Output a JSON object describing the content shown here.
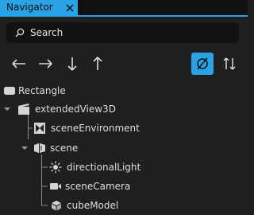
{
  "tab": {
    "title": "Navigator"
  },
  "search": {
    "placeholder": "Search"
  },
  "toolbar": {
    "left_arrow": "←",
    "right_arrow": "→",
    "down_arrow": "↓",
    "up_arrow": "↑"
  },
  "tree": {
    "rectangle": "Rectangle",
    "extended_view": "extendedView3D",
    "scene_environment": "sceneEnvironment",
    "scene": "scene",
    "directional_light": "directionalLight",
    "scene_camera": "sceneCamera",
    "cube_model": "cubeModel"
  },
  "colors": {
    "accent": "#2aa3e6",
    "background": "#1f1f1f",
    "search_bg": "#121212"
  }
}
